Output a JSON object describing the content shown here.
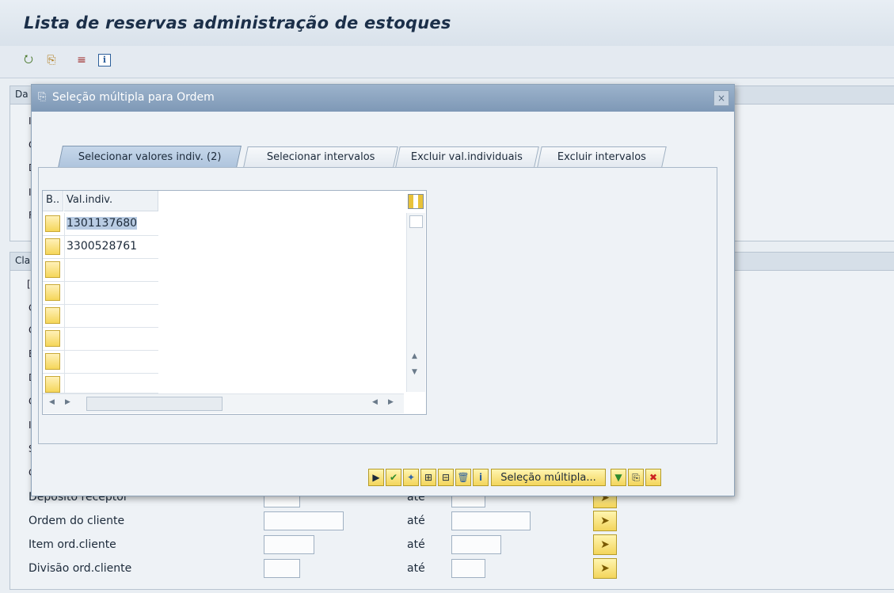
{
  "window": {
    "title": "Lista de reservas administração de estoques"
  },
  "toolbar": {
    "icons": [
      "execute-icon",
      "copy-variant-icon",
      "select-options-icon",
      "info-icon"
    ]
  },
  "background_form": {
    "group1_label_fragment": "Da",
    "group1_row_fragments": [
      "I",
      "C",
      "D",
      "I",
      "F"
    ],
    "group2_label_fragment": "Cla",
    "group2_row_fragments": [
      "[",
      "C",
      "C",
      "E",
      "D",
      "C",
      "I",
      "S",
      "C"
    ],
    "rows": [
      {
        "label": "Deposito receptor",
        "ate": "até"
      },
      {
        "label": "Ordem do cliente",
        "ate": "até"
      },
      {
        "label": "Item ord.cliente",
        "ate": "até"
      },
      {
        "label": "Divisão ord.cliente",
        "ate": "até"
      }
    ]
  },
  "dialog": {
    "title": "Seleção múltipla para Ordem",
    "close_glyph": "×",
    "tabs": [
      {
        "label": "Selecionar valores indiv. (2)",
        "active": true
      },
      {
        "label": "Selecionar intervalos",
        "active": false
      },
      {
        "label": "Excluir val.individuais",
        "active": false
      },
      {
        "label": "Excluir intervalos",
        "active": false
      }
    ],
    "table": {
      "col_b": "B..",
      "col_val": "Val.indiv.",
      "values": [
        "1301137680",
        "3300528761",
        "",
        "",
        "",
        "",
        "",
        ""
      ]
    },
    "buttons": {
      "multi_select_label": "Seleção múltipla...",
      "icons": [
        "execute-icon",
        "check-icon",
        "select-icon",
        "insert-row-icon",
        "delete-row-icon",
        "trash-icon",
        "info-icon"
      ],
      "right_icons": [
        "import-icon",
        "clipboard-icon",
        "cancel-icon"
      ]
    }
  }
}
